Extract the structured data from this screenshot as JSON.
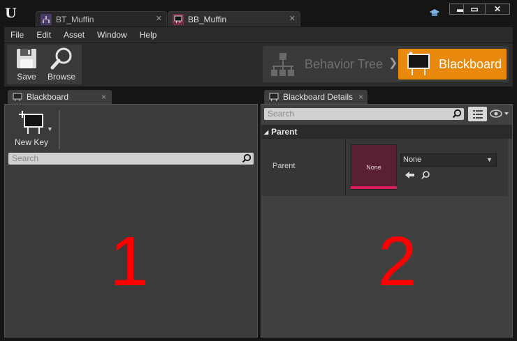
{
  "tabs": [
    {
      "label": "BT_Muffin"
    },
    {
      "label": "BB_Muffin"
    }
  ],
  "window_controls": {
    "minimize": "▬",
    "maximize": "▭",
    "close": "✕"
  },
  "menu": [
    "File",
    "Edit",
    "Asset",
    "Window",
    "Help"
  ],
  "toolbar": {
    "save_label": "Save",
    "browse_label": "Browse"
  },
  "mode_switcher": {
    "behavior_tree_label": "Behavior Tree",
    "blackboard_label": "Blackboard",
    "separator": "❯",
    "accent": "#e8890d"
  },
  "blackboard_panel": {
    "tab_label": "Blackboard",
    "close": "×",
    "new_key_label": "New Key",
    "search_placeholder": "Search",
    "overlay_number": "1"
  },
  "details_panel": {
    "tab_label": "Blackboard Details",
    "close": "×",
    "search_placeholder": "Search",
    "category_label": "Parent",
    "category_arrow": "◢",
    "property_name": "Parent",
    "thumbnail_label": "None",
    "combo_value": "None",
    "overlay_number": "2"
  },
  "icons": [
    "unreal-logo-icon",
    "behavior-tree-icon",
    "blackboard-icon",
    "save-icon",
    "browse-icon",
    "search-icon",
    "list-view-icon",
    "eye-icon",
    "arrow-left-icon"
  ]
}
